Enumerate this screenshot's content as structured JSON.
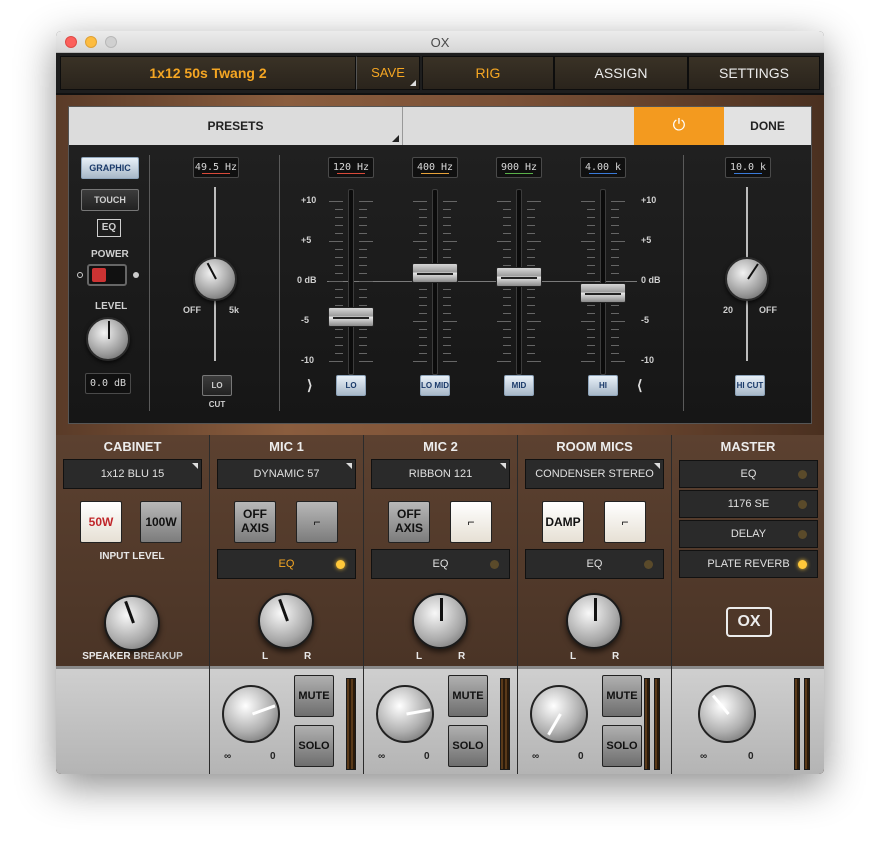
{
  "window": {
    "title": "OX"
  },
  "topbar": {
    "preset_name": "1x12 50s Twang 2",
    "save_label": "SAVE",
    "nav": {
      "rig": "RIG",
      "assign": "ASSIGN",
      "settings": "SETTINGS"
    }
  },
  "eq": {
    "presets_label": "PRESETS",
    "power_icon": "⏻",
    "done_label": "DONE",
    "mode_graphic": "GRAPHIC",
    "mode_touch": "TOUCH",
    "eq_label": "EQ",
    "power_label": "POWER",
    "level_label": "LEVEL",
    "level_value": "0.0 dB",
    "locut": {
      "freq": "49.5 Hz",
      "off": "OFF",
      "max": "5k",
      "button": "LO CUT",
      "knob_percent": 40
    },
    "bands": [
      {
        "freq": "120 Hz",
        "button": "LO",
        "gain_db": -4.5,
        "color": "#d94a3a"
      },
      {
        "freq": "400 Hz",
        "button": "LO MID",
        "gain_db": 1.0,
        "color": "#e6a23a"
      },
      {
        "freq": "900 Hz",
        "button": "MID",
        "gain_db": 0.5,
        "color": "#5ab04a"
      },
      {
        "freq": "4.00 k",
        "button": "HI",
        "gain_db": -1.5,
        "color": "#3a7ad9"
      }
    ],
    "scale": [
      "+10",
      "+5",
      "0 dB",
      "-5",
      "-10"
    ],
    "hicut": {
      "freq": "10.0 k",
      "min": "20",
      "off": "OFF",
      "button": "HI CUT",
      "knob_percent": 62
    }
  },
  "strips": {
    "cabinet": {
      "name": "CABINET",
      "select": "1x12 BLU 15",
      "btn_50w": "50W",
      "btn_100w": "100W",
      "input_level": "INPUT LEVEL",
      "speaker": "SPEAKER",
      "breakup": "BREAKUP"
    },
    "mic1": {
      "name": "MIC 1",
      "select": "DYNAMIC 57",
      "btn_axis": "OFF AXIS",
      "eq": "EQ",
      "mute": "MUTE",
      "solo": "SOLO"
    },
    "mic2": {
      "name": "MIC 2",
      "select": "RIBBON 121",
      "btn_axis": "OFF AXIS",
      "eq": "EQ",
      "mute": "MUTE",
      "solo": "SOLO"
    },
    "room": {
      "name": "ROOM MICS",
      "select": "CONDENSER STEREO",
      "btn_damp": "DAMP",
      "eq": "EQ",
      "mute": "MUTE",
      "solo": "SOLO"
    },
    "master": {
      "name": "MASTER",
      "fx": [
        {
          "label": "EQ",
          "on": false
        },
        {
          "label": "1176 SE",
          "on": false
        },
        {
          "label": "DELAY",
          "on": false
        },
        {
          "label": "PLATE REVERB",
          "on": true
        }
      ],
      "logo": "OX"
    },
    "lr": {
      "l": "L",
      "r": "R"
    },
    "vol": {
      "min": "∞",
      "max": "0"
    }
  }
}
